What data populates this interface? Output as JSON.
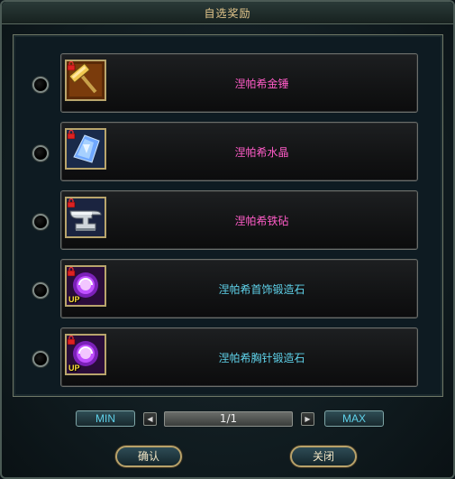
{
  "dialog": {
    "title": "自选奖励"
  },
  "items": [
    {
      "name": "涅帕希金锤",
      "color": "#ff5cc8",
      "icon": "golden-hammer-icon"
    },
    {
      "name": "涅帕希水晶",
      "color": "#ff5cc8",
      "icon": "blue-crystal-icon"
    },
    {
      "name": "涅帕希铁砧",
      "color": "#ff5cc8",
      "icon": "anvil-icon"
    },
    {
      "name": "涅帕希首饰锻造石",
      "color": "#5fd2ea",
      "icon": "purple-forging-stone-icon",
      "badge": "UP"
    },
    {
      "name": "涅帕希胸针锻造石",
      "color": "#5fd2ea",
      "icon": "purple-forging-stone-icon",
      "badge": "UP"
    }
  ],
  "pager": {
    "min_label": "MIN",
    "max_label": "MAX",
    "page_value": "1/1",
    "prev_icon": "arrow-left-icon",
    "next_icon": "arrow-right-icon"
  },
  "buttons": {
    "confirm_label": "确认",
    "close_label": "关闭"
  },
  "colors": {
    "title": "#e6c88c",
    "rare_text": "#ff5cc8",
    "epic_text": "#5fd2ea"
  }
}
